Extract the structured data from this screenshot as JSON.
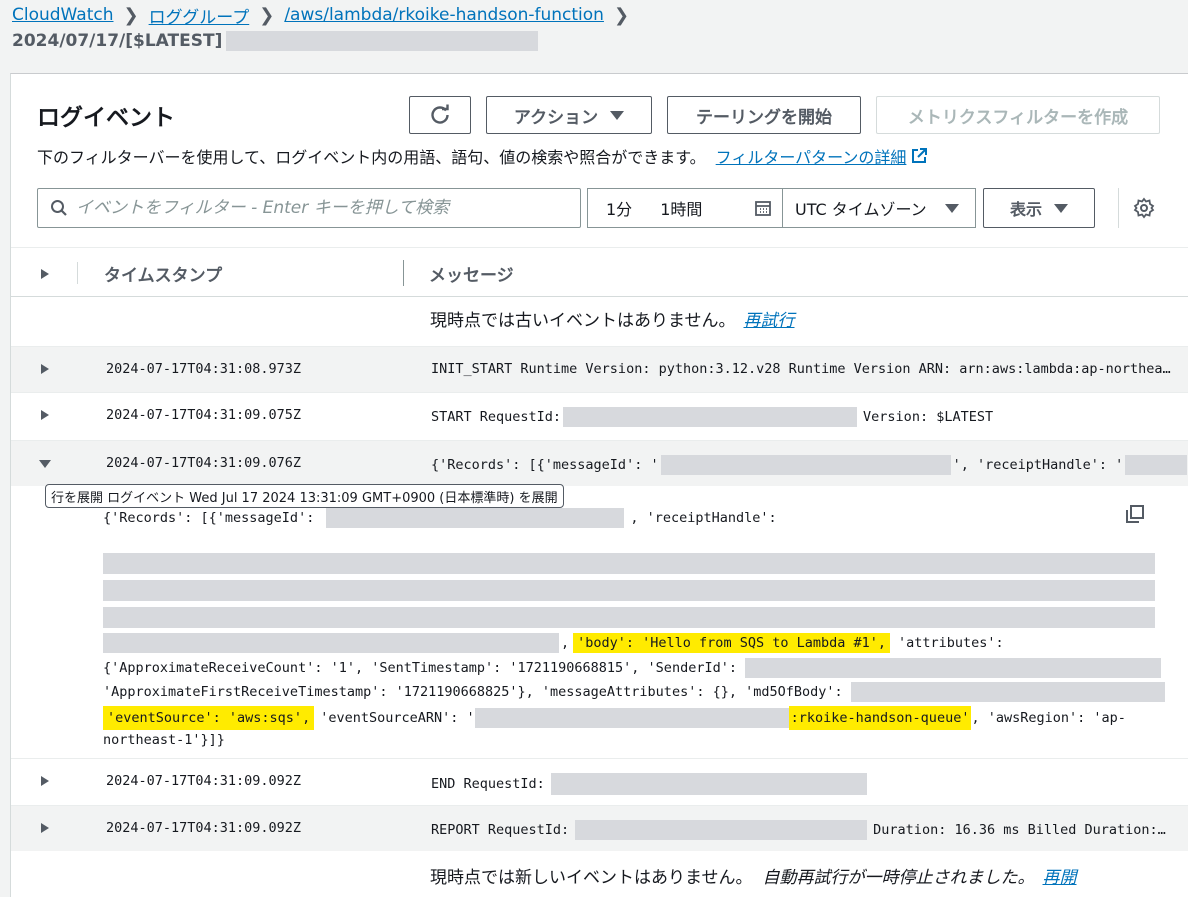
{
  "breadcrumb": {
    "items": [
      "CloudWatch",
      "ロググループ",
      "/aws/lambda/rkoike-handson-function"
    ],
    "stream": "2024/07/17/[$LATEST]"
  },
  "panel": {
    "title": "ログイベント",
    "buttons": {
      "action": "アクション",
      "tail": "テーリングを開始",
      "metric_filter": "メトリクスフィルターを作成"
    },
    "description": "下のフィルターバーを使用して、ログイベント内の用語、語句、値の検索や照合ができます。",
    "description_link": "フィルターパターンの詳細"
  },
  "filter": {
    "search_placeholder": "イベントをフィルター - Enter キーを押して検索",
    "range_1": "1分",
    "range_2": "1時間",
    "timezone": "UTC タイムゾーン",
    "view": "表示"
  },
  "table": {
    "col_timestamp": "タイムスタンプ",
    "col_message": "メッセージ",
    "no_older": "現時点では古いイベントはありません。",
    "retry": "再試行",
    "no_newer": "現時点では新しいイベントはありません。",
    "auto_retry_paused": "自動再試行が一時停止されました。",
    "resume": "再開",
    "rows": [
      {
        "ts": "2024-07-17T04:31:08.973Z",
        "msg": "INIT_START Runtime Version: python:3.12.v28 Runtime Version ARN: arn:aws:lambda:ap-northea…"
      },
      {
        "ts": "2024-07-17T04:31:09.075Z",
        "msg_a": "START RequestId:",
        "msg_b": "Version: $LATEST"
      },
      {
        "ts": "2024-07-17T04:31:09.076Z",
        "msg_a": "{'Records': [{'messageId': '",
        "msg_b": "', 'receiptHandle': '"
      },
      {
        "ts": "2024-07-17T04:31:09.092Z",
        "msg_a": "END RequestId:"
      },
      {
        "ts": "2024-07-17T04:31:09.092Z",
        "msg_a": "REPORT RequestId:",
        "msg_b": "Duration: 16.36 ms Billed Duration:…"
      }
    ]
  },
  "tooltip": "行を展開 ログイベント Wed Jul 17 2024 13:31:09 GMT+0900 (日本標準時) を展開",
  "expanded": {
    "l1a": "{'Records': [{'messageId':",
    "l1b": ", 'receiptHandle':",
    "l5a": ",",
    "l5_hl": "'body': 'Hello from SQS to Lambda #1',",
    "l5b": "'attributes':",
    "l6": "{'ApproximateReceiveCount': '1', 'SentTimestamp': '1721190668815', 'SenderId':",
    "l7": "'ApproximateFirstReceiveTimestamp': '1721190668825'}, 'messageAttributes': {}, 'md5OfBody':",
    "l8_hl1": "'eventSource': 'aws:sqs',",
    "l8a": "'eventSourceARN': '",
    "l8_hl2": ":rkoike-handson-queue'",
    "l8b": ", 'awsRegion': 'ap-",
    "l9": "northeast-1'}]}"
  },
  "colors": {
    "link": "#0073bb",
    "highlight": "#ffeb00",
    "redaction": "#d7d9dd"
  }
}
